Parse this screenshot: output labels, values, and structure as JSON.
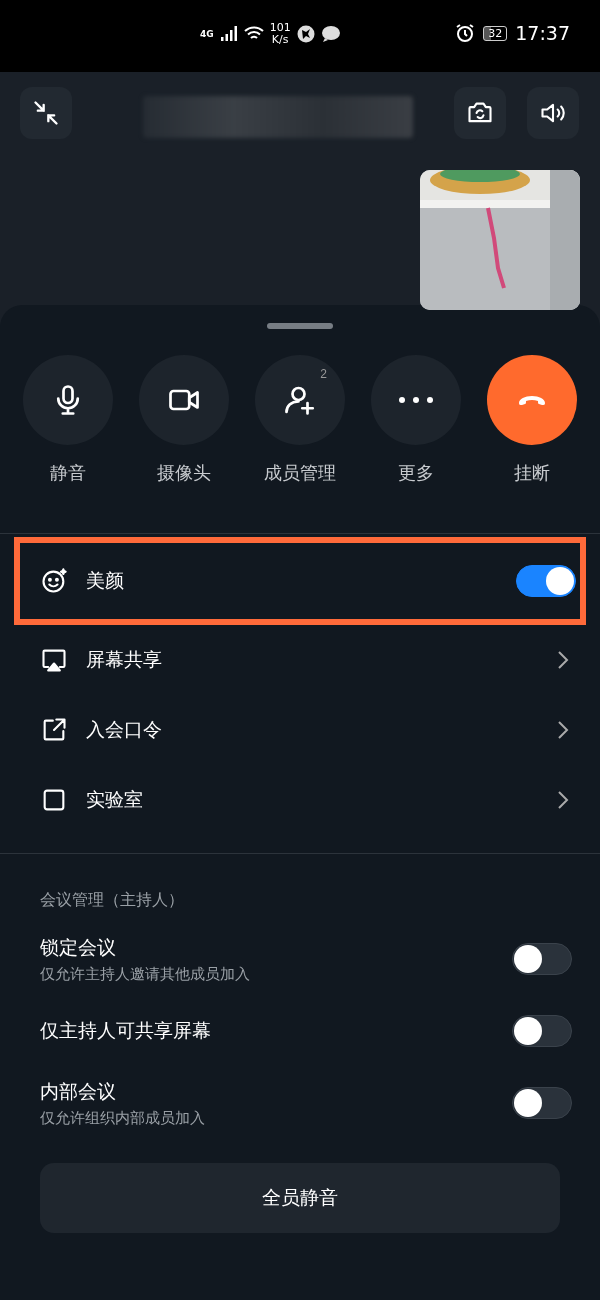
{
  "status_bar": {
    "network": "4G",
    "speed": "101",
    "speed_unit": "K/s",
    "battery": "32",
    "time": "17:37"
  },
  "actions": [
    {
      "label": "静音",
      "kind": "mic"
    },
    {
      "label": "摄像头",
      "kind": "camera"
    },
    {
      "label": "成员管理",
      "kind": "members",
      "badge": "2"
    },
    {
      "label": "更多",
      "kind": "more"
    },
    {
      "label": "挂断",
      "kind": "hangup"
    }
  ],
  "menu": [
    {
      "kind": "toggle",
      "label": "美颜",
      "on": true,
      "highlighted": true
    },
    {
      "kind": "link",
      "label": "屏幕共享",
      "highlighted": false
    },
    {
      "kind": "link",
      "label": "入会口令",
      "highlighted": false
    },
    {
      "kind": "link",
      "label": "实验室",
      "highlighted": false
    }
  ],
  "host_section": {
    "title": "会议管理（主持人）",
    "settings": [
      {
        "label": "锁定会议",
        "description": "仅允许主持人邀请其他成员加入",
        "on": false
      },
      {
        "label": "仅主持人可共享屏幕",
        "on": false
      },
      {
        "label": "内部会议",
        "description": "仅允许组织内部成员加入",
        "on": false
      }
    ]
  },
  "mute_all_button": "全员静音"
}
